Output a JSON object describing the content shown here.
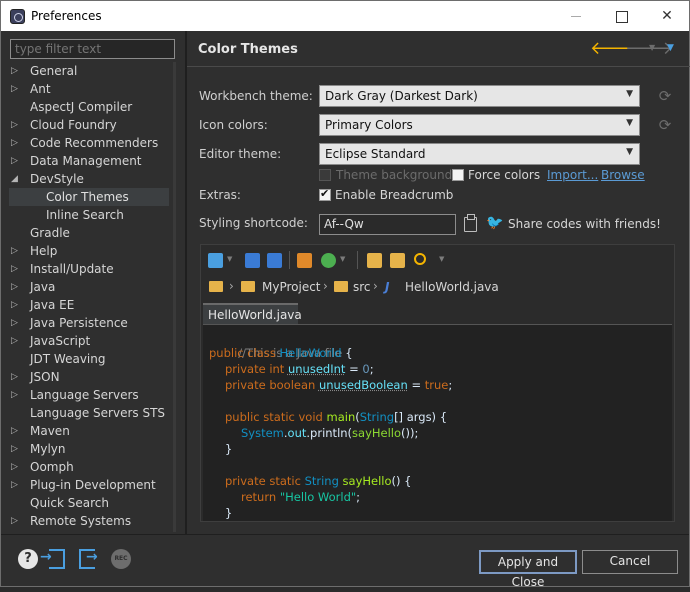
{
  "window": {
    "title": "Preferences"
  },
  "filter": {
    "placeholder": "type filter text"
  },
  "tree": {
    "items": [
      {
        "label": "General",
        "expandable": true,
        "child": false
      },
      {
        "label": "Ant",
        "expandable": true,
        "child": false
      },
      {
        "label": "AspectJ Compiler",
        "expandable": false,
        "child": false
      },
      {
        "label": "Cloud Foundry",
        "expandable": true,
        "child": false
      },
      {
        "label": "Code Recommenders",
        "expandable": true,
        "child": false
      },
      {
        "label": "Data Management",
        "expandable": true,
        "child": false
      },
      {
        "label": "DevStyle",
        "expandable": true,
        "expanded": true,
        "child": false
      },
      {
        "label": "Color Themes",
        "expandable": false,
        "child": true,
        "selected": true
      },
      {
        "label": "Inline Search",
        "expandable": false,
        "child": true
      },
      {
        "label": "Gradle",
        "expandable": false,
        "child": false
      },
      {
        "label": "Help",
        "expandable": true,
        "child": false
      },
      {
        "label": "Install/Update",
        "expandable": true,
        "child": false
      },
      {
        "label": "Java",
        "expandable": true,
        "child": false
      },
      {
        "label": "Java EE",
        "expandable": true,
        "child": false
      },
      {
        "label": "Java Persistence",
        "expandable": true,
        "child": false
      },
      {
        "label": "JavaScript",
        "expandable": true,
        "child": false
      },
      {
        "label": "JDT Weaving",
        "expandable": false,
        "child": false
      },
      {
        "label": "JSON",
        "expandable": true,
        "child": false
      },
      {
        "label": "Language Servers",
        "expandable": true,
        "child": false
      },
      {
        "label": "Language Servers STS",
        "expandable": false,
        "child": false
      },
      {
        "label": "Maven",
        "expandable": true,
        "child": false
      },
      {
        "label": "Mylyn",
        "expandable": true,
        "child": false
      },
      {
        "label": "Oomph",
        "expandable": true,
        "child": false
      },
      {
        "label": "Plug-in Development",
        "expandable": true,
        "child": false
      },
      {
        "label": "Quick Search",
        "expandable": false,
        "child": false
      },
      {
        "label": "Remote Systems",
        "expandable": true,
        "child": false
      }
    ]
  },
  "page": {
    "title": "Color Themes",
    "workbench_theme": {
      "label": "Workbench theme:",
      "value": "Dark Gray (Darkest Dark)"
    },
    "icon_colors": {
      "label": "Icon colors:",
      "value": "Primary Colors"
    },
    "editor_theme": {
      "label": "Editor theme:",
      "value": "Eclipse Standard"
    },
    "theme_background": {
      "label": "Theme background",
      "checked": false,
      "enabled": false
    },
    "force_colors": {
      "label": "Force colors",
      "checked": false
    },
    "import_link": "Import...",
    "browse_link": "Browse",
    "extras": {
      "label": "Extras:",
      "breadcrumb_label": "Enable Breadcrumb",
      "breadcrumb_checked": true
    },
    "shortcode": {
      "label": "Styling shortcode:",
      "value": "Af--Qw"
    },
    "share_text": "Share codes with friends!"
  },
  "preview": {
    "breadcrumb": {
      "project": "MyProject",
      "folder": "src",
      "file": "HelloWorld.java"
    },
    "tab_label": "HelloWorld.java",
    "code": {
      "l1": "//This is a Java file",
      "kw_public": "public",
      "kw_class": "class",
      "class_name": "HelloWorld",
      "brace_open": "{",
      "kw_private": "private",
      "kw_int": "int",
      "field_int": "unusedInt",
      "eq": "=",
      "num0": "0",
      "semi": ";",
      "kw_boolean": "boolean",
      "field_bool": "unusedBoolean",
      "kw_true": "true",
      "kw_static": "static",
      "kw_void": "void",
      "method_main": "main",
      "type_string": "String",
      "main_params": "[] args) {",
      "paren_open": "(",
      "system": "System",
      "dot_out": ".",
      "out": "out",
      "println": ".println(",
      "say_hello_call": "sayHello",
      "call_close": "());",
      "brace_close": "}",
      "method_say_hello": "sayHello",
      "say_hello_sig": "() {",
      "kw_return": "return",
      "str_hello": "\"Hello World\""
    }
  },
  "buttons": {
    "apply_close": "Apply and Close",
    "cancel": "Cancel"
  },
  "bottom_icons": {
    "rec": "REC"
  },
  "colors": {
    "accent_back": "#f4b400",
    "link": "#5b9bd5",
    "twitter": "#1da1f2"
  }
}
